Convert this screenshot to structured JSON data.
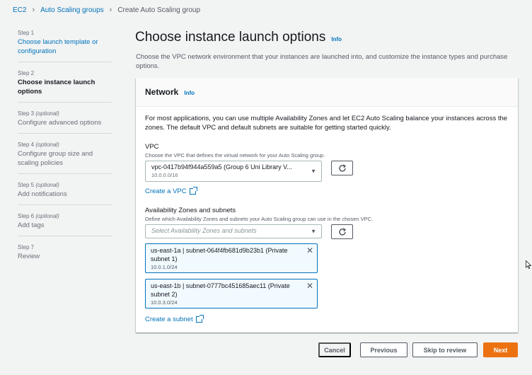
{
  "breadcrumb": [
    "EC2",
    "Auto Scaling groups",
    "Create Auto Scaling group"
  ],
  "steps": [
    {
      "num": "Step 1",
      "optional": "",
      "title": "Choose launch template or configuration",
      "state": "link"
    },
    {
      "num": "Step 2",
      "optional": "",
      "title": "Choose instance launch options",
      "state": "active"
    },
    {
      "num": "Step 3",
      "optional": "(optional)",
      "title": "Configure advanced options",
      "state": "disabled"
    },
    {
      "num": "Step 4",
      "optional": "(optional)",
      "title": "Configure group size and scaling policies",
      "state": "disabled"
    },
    {
      "num": "Step 5",
      "optional": "(optional)",
      "title": "Add notifications",
      "state": "disabled"
    },
    {
      "num": "Step 6",
      "optional": "(optional)",
      "title": "Add tags",
      "state": "disabled"
    },
    {
      "num": "Step 7",
      "optional": "",
      "title": "Review",
      "state": "disabled"
    }
  ],
  "page": {
    "title": "Choose instance launch options",
    "info": "Info",
    "description": "Choose the VPC network environment that your instances are launched into, and customize the instance types and purchase options."
  },
  "network": {
    "title": "Network",
    "info": "Info",
    "description": "For most applications, you can use multiple Availability Zones and let EC2 Auto Scaling balance your instances across the zones. The default VPC and default subnets are suitable for getting started quickly.",
    "vpc_label": "VPC",
    "vpc_hint": "Choose the VPC that defines the virtual network for your Auto Scaling group.",
    "vpc_value": "vpc-0417b94f944a559a5 (Group 6 Uni Library V...",
    "vpc_cidr": "10.0.0.0/16",
    "create_vpc": "Create a VPC",
    "az_label": "Availability Zones and subnets",
    "az_hint": "Define which Availability Zones and subnets your Auto Scaling group can use in the chosen VPC.",
    "az_placeholder": "Select Availability Zones and subnets",
    "subnets": [
      {
        "text": "us-east-1a | subnet-064f4fb681d9b23b1 (Private subnet 1)",
        "cidr": "10.0.1.0/24"
      },
      {
        "text": "us-east-1b | subnet-0777bc451685aec11 (Private subnet 2)",
        "cidr": "10.0.3.0/24"
      }
    ],
    "create_subnet": "Create a subnet"
  },
  "footer": {
    "cancel": "Cancel",
    "previous": "Previous",
    "skip": "Skip to review",
    "next": "Next"
  },
  "icons": {
    "refresh": "refresh-icon",
    "external": "external-link-icon",
    "dropdown": "caret-down-icon",
    "close": "close-icon"
  },
  "colors": {
    "accent": "#0073bb",
    "primary": "#ec7211",
    "background": "#f2f3f3"
  }
}
